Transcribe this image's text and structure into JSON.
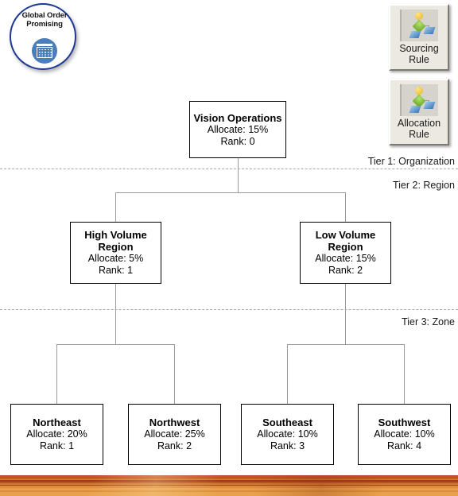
{
  "logo": {
    "title_line1": "Global Order",
    "title_line2": "Promising",
    "icon": "calendar-icon",
    "border_color": "#1f3a93",
    "icon_color": "#4a7ebb"
  },
  "toolbar": {
    "buttons": [
      {
        "label_line1": "Sourcing",
        "label_line2": "Rule",
        "icon": "hierarchy-tree-icon"
      },
      {
        "label_line1": "Allocation",
        "label_line2": "Rule",
        "icon": "hierarchy-tree-icon"
      }
    ]
  },
  "tiers": [
    {
      "label": "Tier 1: Organization"
    },
    {
      "label": "Tier 2: Region"
    },
    {
      "label": "Tier 3: Zone"
    }
  ],
  "hierarchy": {
    "root": {
      "title": "Vision Operations",
      "allocate": "Allocate: 15%",
      "rank": "Rank: 0"
    },
    "regions": [
      {
        "title_line1": "High Volume",
        "title_line2": "Region",
        "allocate": "Allocate: 5%",
        "rank": "Rank: 1"
      },
      {
        "title_line1": "Low Volume",
        "title_line2": "Region",
        "allocate": "Allocate: 15%",
        "rank": "Rank: 2"
      }
    ],
    "zones": [
      {
        "title": "Northeast",
        "allocate": "Allocate: 20%",
        "rank": "Rank: 1"
      },
      {
        "title": "Northwest",
        "allocate": "Allocate: 25%",
        "rank": "Rank: 2"
      },
      {
        "title": "Southeast",
        "allocate": "Allocate: 10%",
        "rank": "Rank: 3"
      },
      {
        "title": "Southwest",
        "allocate": "Allocate: 10%",
        "rank": "Rank: 4"
      }
    ]
  },
  "colors": {
    "node_border": "#000000",
    "connector": "#9a9a9a",
    "tier_divider": "#a9a9a9",
    "wood_dark": "#a53d1c",
    "wood_light": "#e9a24c"
  }
}
